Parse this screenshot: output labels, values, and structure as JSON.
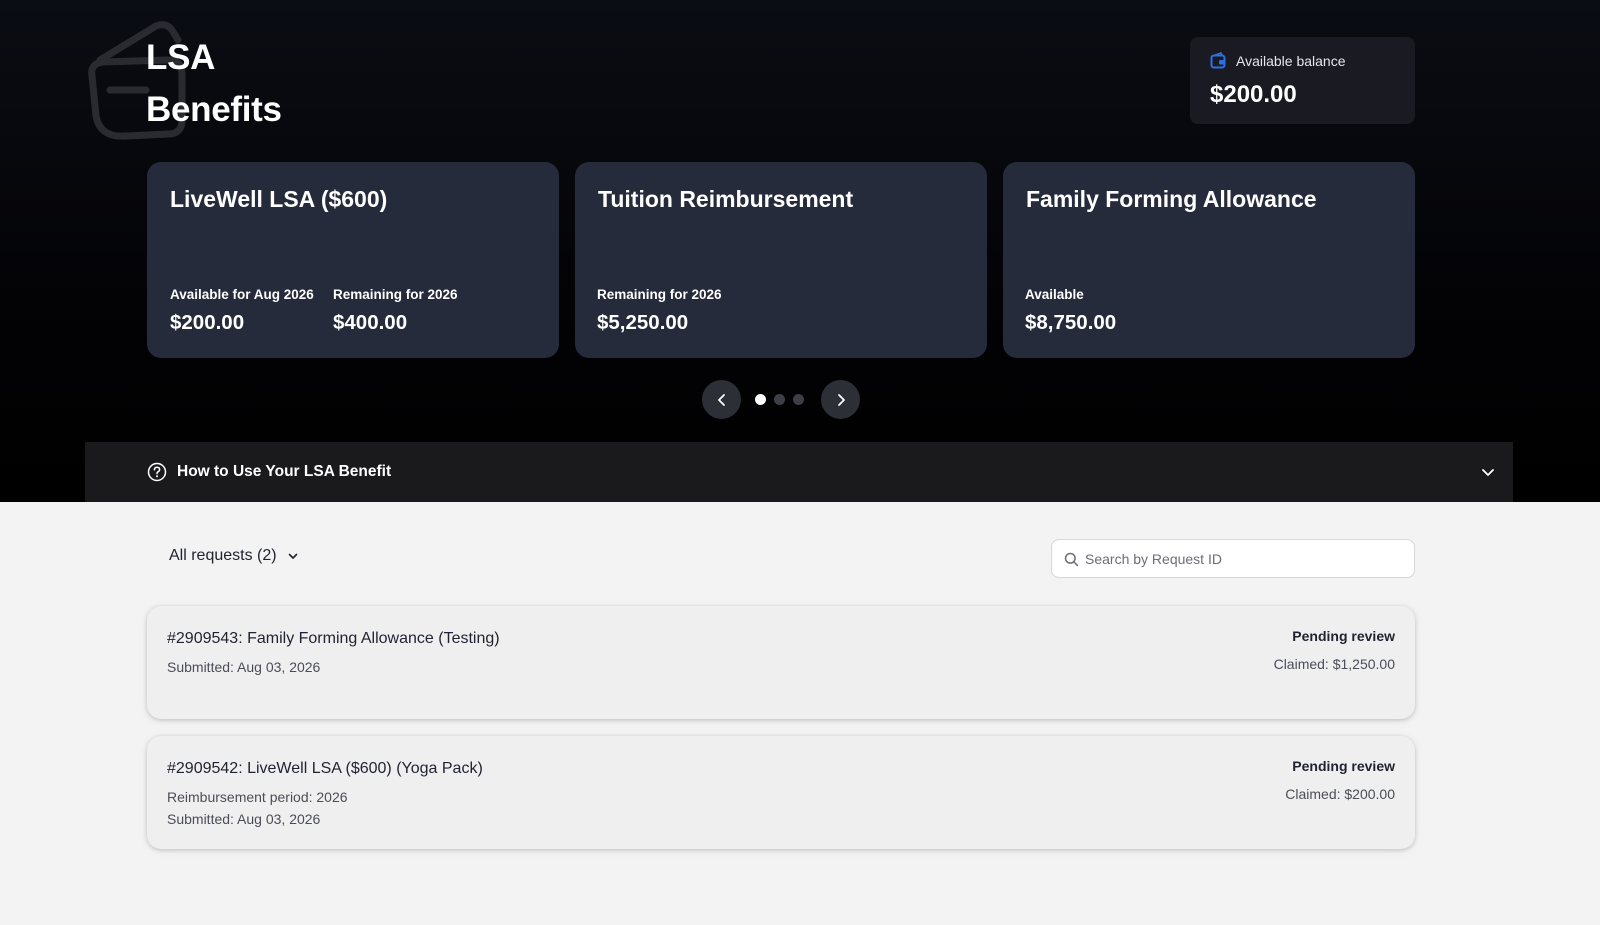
{
  "header": {
    "title_line1": "LSA",
    "title_line2": "Benefits"
  },
  "balance": {
    "label": "Available balance",
    "amount": "$200.00",
    "icon": "wallet-icon",
    "icon_color": "#2f6fe4"
  },
  "benefits": [
    {
      "name": "LiveWell LSA ($600)",
      "stats": [
        {
          "label": "Available for Aug 2026",
          "value": "$200.00"
        },
        {
          "label": "Remaining for 2026",
          "value": "$400.00"
        }
      ]
    },
    {
      "name": "Tuition Reimbursement",
      "stats": [
        {
          "label": "Remaining for 2026",
          "value": "$5,250.00"
        }
      ]
    },
    {
      "name": "Family Forming Allowance",
      "stats": [
        {
          "label": "Available",
          "value": "$8,750.00"
        }
      ]
    }
  ],
  "carousel": {
    "page_count": 3,
    "active_page": 1
  },
  "howto": {
    "label": "How to Use Your LSA Benefit"
  },
  "requests": {
    "filter_label": "All requests (2)",
    "search_placeholder": "Search by Request ID",
    "items": [
      {
        "title": "#2909543: Family Forming Allowance (Testing)",
        "meta": [
          "Submitted: Aug 03, 2026"
        ],
        "status": "Pending review",
        "claimed": "Claimed: $1,250.00"
      },
      {
        "title": "#2909542: LiveWell LSA ($600) (Yoga Pack)",
        "meta": [
          "Reimbursement period: 2026",
          "Submitted: Aug 03, 2026"
        ],
        "status": "Pending review",
        "claimed": "Claimed: $200.00"
      }
    ]
  },
  "colors": {
    "hero_bg": "#030306",
    "card_bg": "#252b3a",
    "page_bg": "#f3f3f3"
  }
}
